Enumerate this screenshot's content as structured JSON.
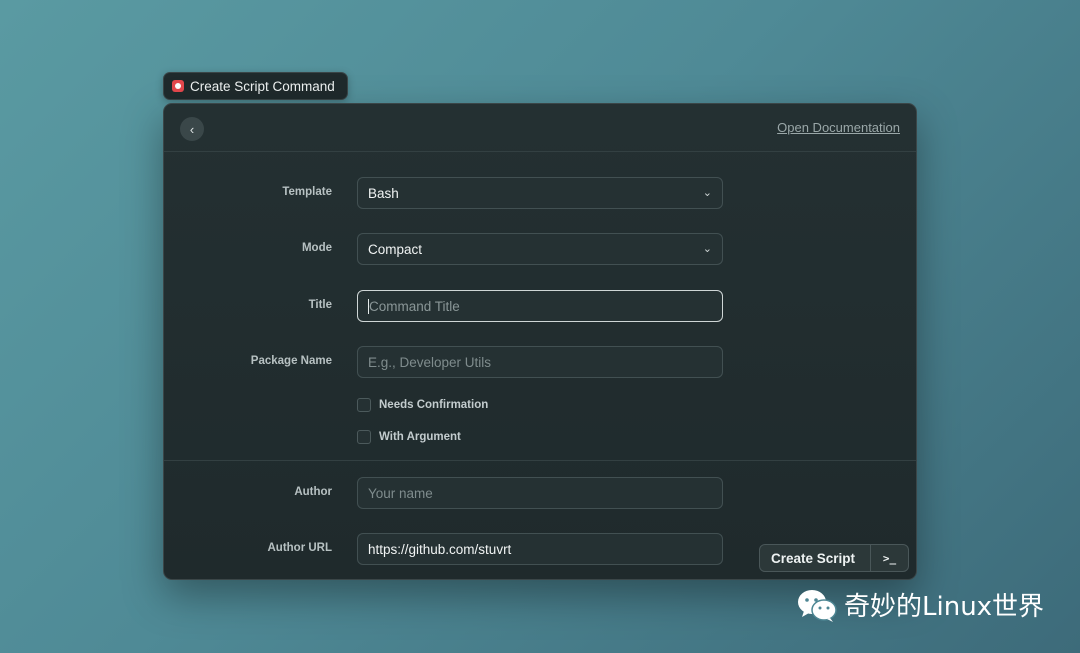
{
  "window_title": "Create Script Command",
  "header": {
    "back_label": "‹",
    "doc_link": "Open Documentation"
  },
  "form": {
    "template": {
      "label": "Template",
      "value": "Bash"
    },
    "mode": {
      "label": "Mode",
      "value": "Compact"
    },
    "title": {
      "label": "Title",
      "placeholder": "Command Title"
    },
    "package_name": {
      "label": "Package Name",
      "placeholder": "E.g., Developer Utils"
    },
    "needs_confirmation": {
      "label": "Needs Confirmation",
      "checked": false
    },
    "with_argument": {
      "label": "With Argument",
      "checked": false
    },
    "author": {
      "label": "Author",
      "placeholder": "Your name"
    },
    "author_url": {
      "label": "Author URL",
      "value": "https://github.com/stuvrt"
    }
  },
  "action": {
    "label": "Create Script",
    "shortcut": ">_"
  },
  "watermark": {
    "text": "奇妙的Linux世界",
    "icon": "wechat-icon"
  },
  "colors": {
    "accent": "#e5484d",
    "window_bg": "#1f2a2c"
  }
}
